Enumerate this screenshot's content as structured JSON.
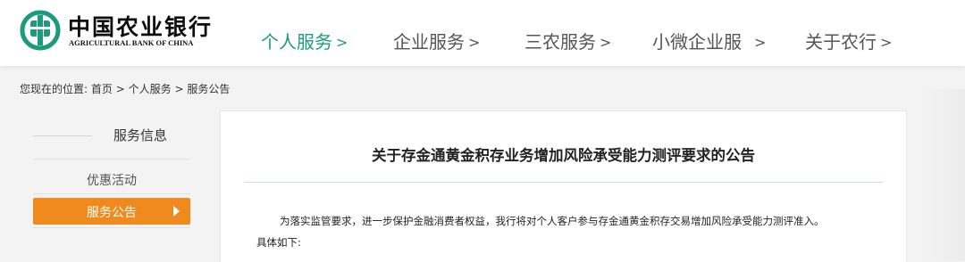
{
  "header": {
    "logo_cn": "中国农业银行",
    "logo_en": "AGRICULTURAL BANK OF CHINA",
    "brand_color": "#1c9a7c",
    "nav": [
      {
        "label": "个人服务",
        "chevron": ">"
      },
      {
        "label": "企业服务",
        "chevron": ">"
      },
      {
        "label": "三农服务",
        "chevron": ">"
      },
      {
        "label": "小微企业服",
        "chevron": ">"
      },
      {
        "label": "关于农行",
        "chevron": ">"
      }
    ]
  },
  "breadcrumb": {
    "prefix": "您现在的位置:",
    "items": [
      "首页",
      "个人服务",
      "服务公告"
    ],
    "sep": ">"
  },
  "sidebar": {
    "title": "服务信息",
    "items": [
      {
        "label": "优惠活动",
        "active": false
      },
      {
        "label": "服务公告",
        "active": true
      }
    ],
    "active_color": "#f08a1d"
  },
  "article": {
    "title": "关于存金通黄金积存业务增加风险承受能力测评要求的公告",
    "paragraph1": "为落实监管要求，进一步保护金融消费者权益，我行将对个人客户参与存金通黄金积存交易增加风险承受能力测评准入。",
    "paragraph2": "具体如下:"
  }
}
